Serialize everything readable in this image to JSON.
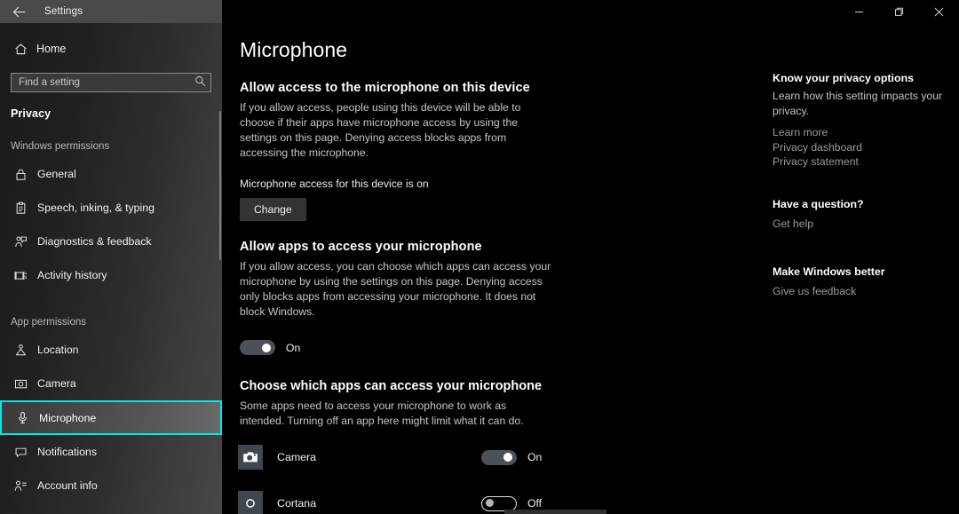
{
  "window": {
    "title": "Settings",
    "back_icon": "back-arrow-icon",
    "minimize_label": "Minimize",
    "restore_label": "Restore",
    "close_label": "Close"
  },
  "sidebar": {
    "home_label": "Home",
    "home_icon": "home-icon",
    "search": {
      "placeholder": "Find a setting",
      "value": "",
      "icon": "search-icon"
    },
    "category": "Privacy",
    "groups": [
      {
        "title": "Windows permissions",
        "items": [
          {
            "label": "General",
            "icon": "lock-icon",
            "selected": false
          },
          {
            "label": "Speech, inking, & typing",
            "icon": "clipboard-icon",
            "selected": false
          },
          {
            "label": "Diagnostics & feedback",
            "icon": "feedback-person-icon",
            "selected": false
          },
          {
            "label": "Activity history",
            "icon": "activity-history-icon",
            "selected": false
          }
        ]
      },
      {
        "title": "App permissions",
        "items": [
          {
            "label": "Location",
            "icon": "location-pin-icon",
            "selected": false
          },
          {
            "label": "Camera",
            "icon": "camera-icon",
            "selected": false
          },
          {
            "label": "Microphone",
            "icon": "microphone-icon",
            "selected": true
          },
          {
            "label": "Notifications",
            "icon": "notification-icon",
            "selected": false
          },
          {
            "label": "Account info",
            "icon": "account-info-icon",
            "selected": false
          }
        ]
      }
    ],
    "highlight_color": "#00e8e8"
  },
  "main": {
    "page_title": "Microphone",
    "device_section": {
      "heading": "Allow access to the microphone on this device",
      "description": "If you allow access, people using this device will be able to choose if their apps have microphone access by using the settings on this page. Denying access blocks apps from accessing the microphone.",
      "status": "Microphone access for this device is on",
      "change_button": "Change"
    },
    "apps_access_section": {
      "heading": "Allow apps to access your microphone",
      "description": "If you allow access, you can choose which apps can access your microphone by using the settings on this page. Denying access only blocks apps from accessing your microphone. It does not block Windows.",
      "toggle_state": "On"
    },
    "choose_apps_section": {
      "heading": "Choose which apps can access your microphone",
      "description": "Some apps need to access your microphone to work as intended. Turning off an app here might limit what it can do.",
      "apps": [
        {
          "name": "Camera",
          "icon": "camera-app-icon",
          "state": "On"
        },
        {
          "name": "Cortana",
          "icon": "cortana-ring-icon",
          "state": "Off"
        }
      ]
    }
  },
  "rail": {
    "blocks": [
      {
        "heading": "Know your privacy options",
        "body": "Learn how this setting impacts your privacy.",
        "links": [
          "Learn more",
          "Privacy dashboard",
          "Privacy statement"
        ]
      },
      {
        "heading": "Have a question?",
        "body": "",
        "links": [
          "Get help"
        ]
      },
      {
        "heading": "Make Windows better",
        "body": "",
        "links": [
          "Give us feedback"
        ]
      }
    ]
  }
}
